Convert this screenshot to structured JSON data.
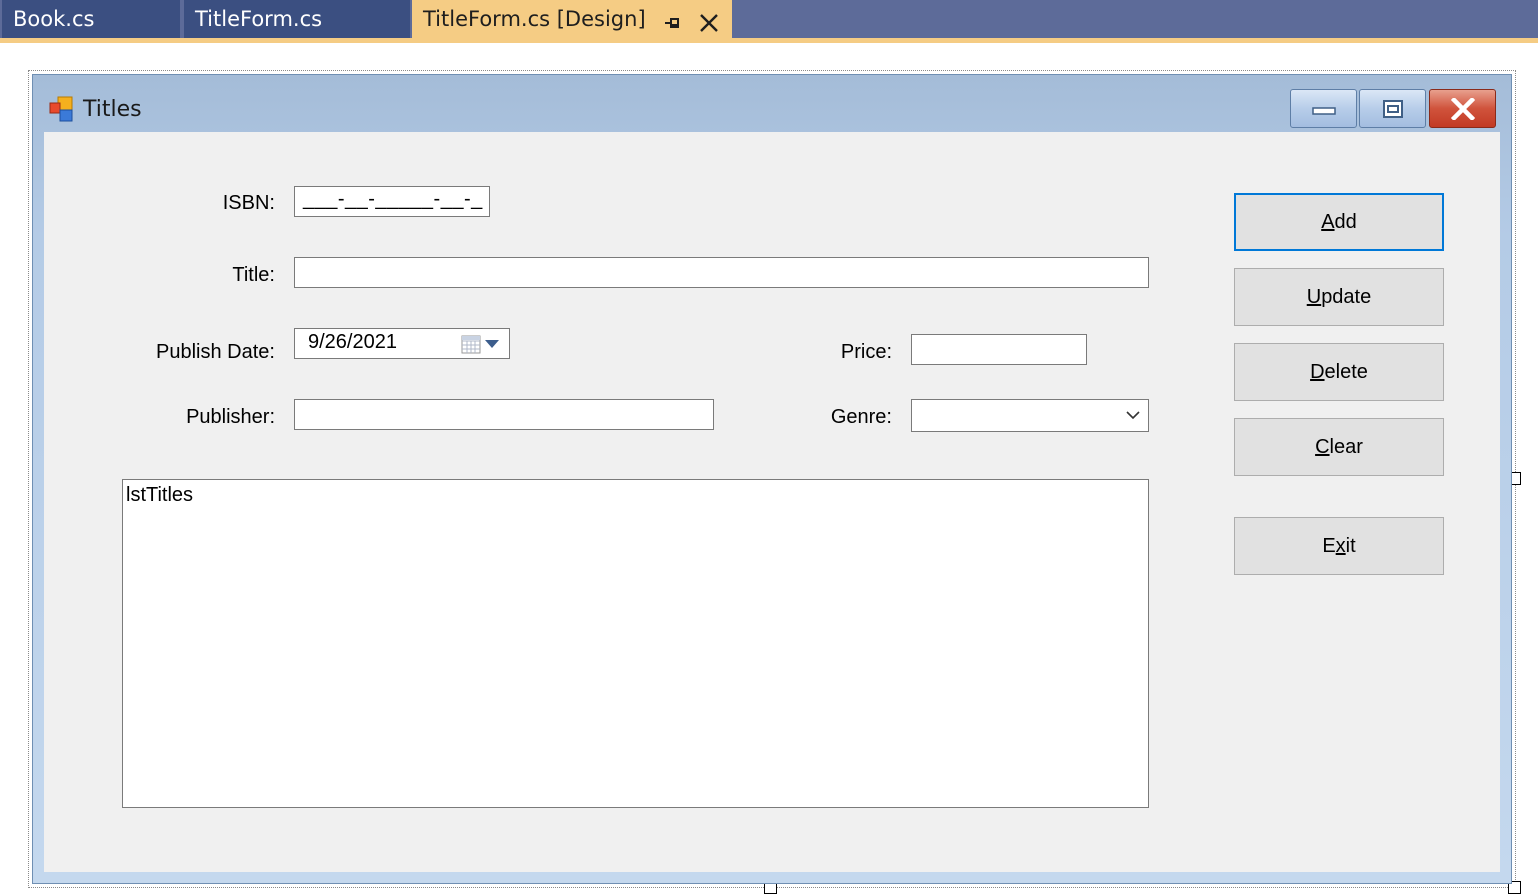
{
  "tabs": [
    {
      "label": "Book.cs",
      "state": "inactive"
    },
    {
      "label": "TitleForm.cs",
      "state": "inactive"
    },
    {
      "label": "TitleForm.cs [Design]",
      "state": "active"
    }
  ],
  "form": {
    "title": "Titles",
    "fields": {
      "isbn_label": "ISBN:",
      "isbn_value": "___-__-_____-__-_",
      "title_label": "Title:",
      "title_value": "",
      "publish_date_label": "Publish Date:",
      "publish_date_value": "9/26/2021",
      "price_label": "Price:",
      "price_value": "",
      "publisher_label": "Publisher:",
      "publisher_value": "",
      "genre_label": "Genre:",
      "genre_value": ""
    },
    "listbox": {
      "name": "lstTitles"
    },
    "buttons": [
      {
        "mnemonic": "A",
        "rest": "dd",
        "default": true
      },
      {
        "mnemonic": "U",
        "rest": "pdate",
        "default": false
      },
      {
        "mnemonic": "D",
        "rest": "elete",
        "default": false
      },
      {
        "mnemonic": "C",
        "rest": "lear",
        "default": false
      },
      {
        "pre": "E",
        "mnemonic": "x",
        "rest": "it",
        "default": false
      }
    ]
  },
  "colors": {
    "tab_strip": "#5d6b99",
    "tab_inactive": "#3b4f81",
    "tab_active": "#f5cc84",
    "form_frame": "#b4cbe6",
    "client": "#f0f0f0",
    "default_button_border": "#0078d7",
    "close_button": "#c94a33"
  },
  "icons": [
    "pin-icon",
    "close-icon",
    "form-app-icon",
    "minimize-icon",
    "maximize-icon",
    "window-close-icon",
    "calendar-icon",
    "dropdown-arrow-icon",
    "chevron-down-icon"
  ]
}
